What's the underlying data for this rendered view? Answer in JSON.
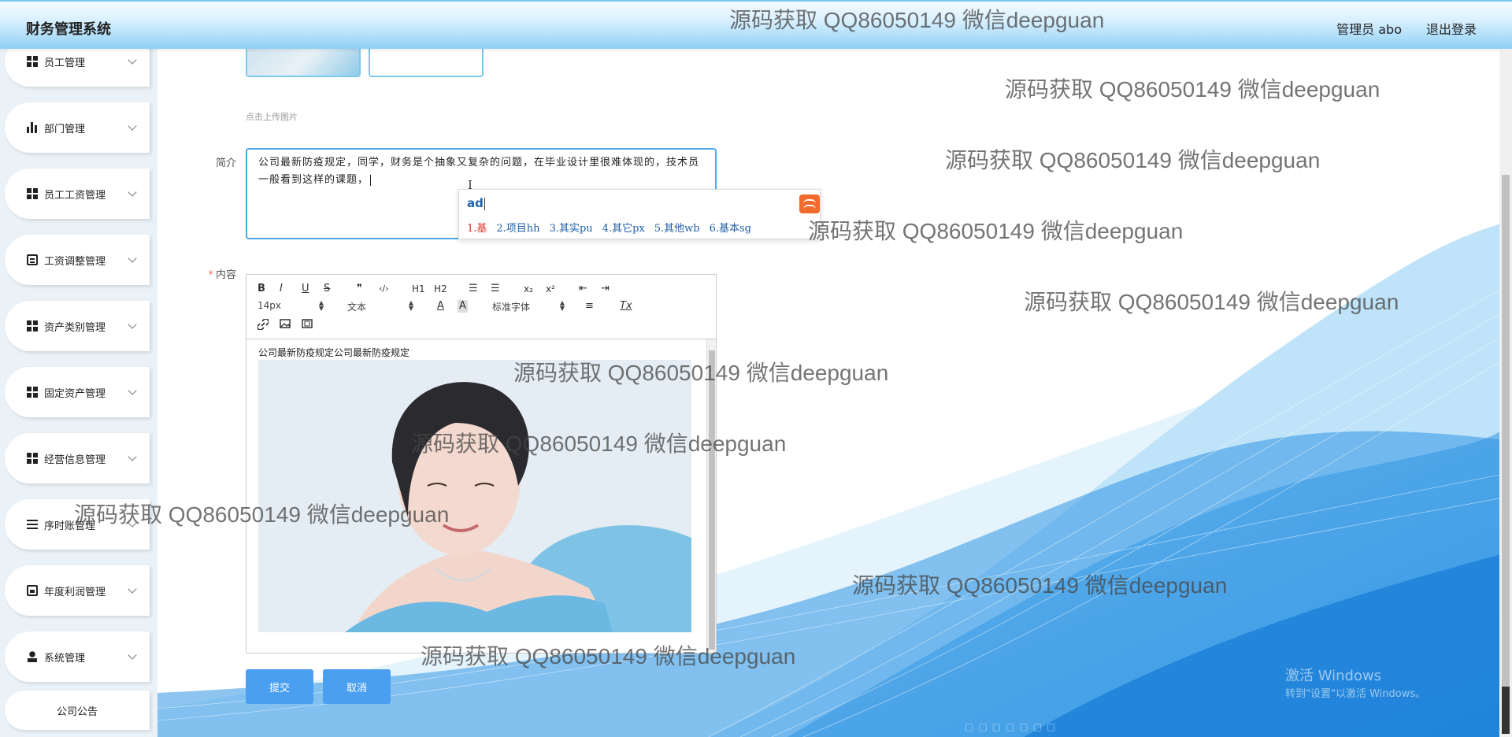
{
  "header": {
    "app_title": "财务管理系统",
    "user_label": "管理员 abo",
    "logout_label": "退出登录"
  },
  "sidebar": {
    "items": [
      {
        "label": "员工管理",
        "icon": "grid-icon"
      },
      {
        "label": "部门管理",
        "icon": "bar-chart-icon"
      },
      {
        "label": "员工工资管理",
        "icon": "grid-icon"
      },
      {
        "label": "工资调整管理",
        "icon": "clipboard-icon"
      },
      {
        "label": "资产类别管理",
        "icon": "grid-icon"
      },
      {
        "label": "固定资产管理",
        "icon": "grid-icon"
      },
      {
        "label": "经营信息管理",
        "icon": "grid-icon"
      },
      {
        "label": "序时账管理",
        "icon": "list-icon"
      },
      {
        "label": "年度利润管理",
        "icon": "checklist-icon"
      },
      {
        "label": "系统管理",
        "icon": "user-icon"
      },
      {
        "label": "公司公告",
        "icon": ""
      }
    ]
  },
  "form": {
    "upload_hint": "点击上传图片",
    "intro_label": "简介",
    "intro_value": "公司最新防疫规定，同学，财务是个抽象又复杂的问题，在毕业设计里很难体现的，技术员一般看到这样的课题，",
    "content_label": "内容",
    "required_mark": "*",
    "submit_label": "提交",
    "cancel_label": "取消"
  },
  "ime": {
    "input": "ad",
    "candidates": [
      "1.基",
      "2.项目hh",
      "3.其实pu",
      "4.其它px",
      "5.其他wb",
      "6.基本sg"
    ],
    "more": "‹"
  },
  "editor": {
    "toolbar": {
      "bold": "B",
      "italic": "I",
      "underline": "U",
      "strike": "S",
      "quote": "❞",
      "code": "‹/›",
      "h1": "H1",
      "h2": "H2",
      "ordered_list": "☰",
      "bullet_list": "☰",
      "subscript": "x₂",
      "superscript": "x²",
      "outdent": "⇤",
      "indent": "⇥",
      "size_value": "14px",
      "format_value": "文本",
      "font_value": "标准字体",
      "color": "A",
      "background": "A",
      "align": "≡",
      "clean": "Tx"
    },
    "body_text": "公司最新防疫规定公司最新防疫规定"
  },
  "watermark": "源码获取 QQ86050149 微信deepguan",
  "os_overlay": {
    "activate_title": "激活 Windows",
    "activate_sub": "转到\"设置\"以激活 Windows。"
  },
  "colors": {
    "accent": "#4a9ff0",
    "header_gradient_end": "#8fd0f5",
    "sidebar_bg": "#eaf2f8",
    "required": "#f56c6c",
    "ime_candidate": "#1f5fa8",
    "ime_highlight": "#e0322c"
  }
}
